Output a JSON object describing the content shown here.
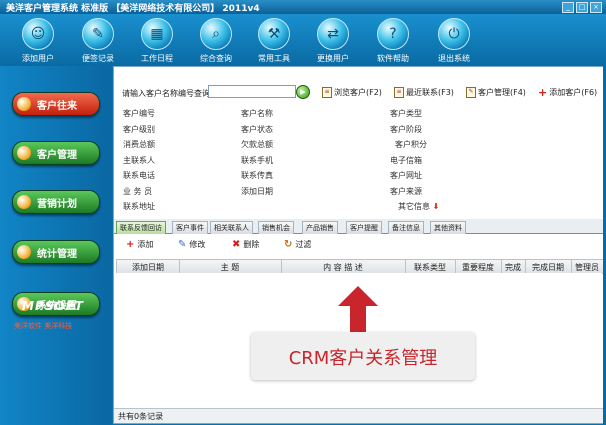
{
  "window": {
    "title": "美洋客户管理系统 标准版 【美洋网络技术有限公司】 2011v4",
    "controls": [
      "_",
      "□",
      "×"
    ]
  },
  "toolbar": [
    {
      "label": "添加用户",
      "icon": "add-user-icon"
    },
    {
      "label": "便签记录",
      "icon": "notes-icon"
    },
    {
      "label": "工作日程",
      "icon": "schedule-icon"
    },
    {
      "label": "综合查询",
      "icon": "query-icon"
    },
    {
      "label": "常用工具",
      "icon": "tools-icon"
    },
    {
      "label": "更换用户",
      "icon": "switch-user-icon"
    },
    {
      "label": "软件帮助",
      "icon": "help-icon"
    },
    {
      "label": "退出系统",
      "icon": "power-icon"
    }
  ],
  "sidebar": [
    {
      "label": "客户往来",
      "color": "#d2341c"
    },
    {
      "label": "客户管理",
      "color": "#2c8c2f"
    },
    {
      "label": "营销计划",
      "color": "#2c8c2f"
    },
    {
      "label": "统计管理",
      "color": "#2c8c2f"
    },
    {
      "label": "系统设置",
      "color": "#2c8c2f"
    }
  ],
  "logo": {
    "text": "MPSOFT",
    "tagline": "美洋软件 美洋科技"
  },
  "search": {
    "label": "请输入客户名称编号查询：",
    "value": "",
    "go": "▶"
  },
  "actions": [
    {
      "label": "浏览客户(F2)"
    },
    {
      "label": "最近联系(F3)"
    },
    {
      "label": "客户管理(F4)"
    },
    {
      "label": "添加客户(F6)"
    }
  ],
  "fields": {
    "col1": [
      "客户编号",
      "客户级别",
      "消费总额",
      "主联系人",
      "联系电话",
      "业 务 员",
      "联系地址"
    ],
    "col2": [
      "客户名称",
      "客户状态",
      "欠款总额",
      "联系手机",
      "联系传真",
      "添加日期"
    ],
    "col3": [
      "客户类型",
      "客户阶段",
      "客户积分",
      "电子信箱",
      "客户网址",
      "客户来源",
      "其它信息"
    ]
  },
  "tabs": [
    "联系反馈回访",
    "客户事件",
    "相关联系人",
    "销售机会",
    "产品销售",
    "客户提醒",
    "备注信息",
    "其他资料"
  ],
  "subtoolbar": [
    {
      "label": "添加",
      "icon": "add-icon"
    },
    {
      "label": "修改",
      "icon": "edit-icon"
    },
    {
      "label": "删除",
      "icon": "delete-icon"
    },
    {
      "label": "过滤",
      "icon": "filter-icon"
    }
  ],
  "grid": {
    "headers": [
      "添加日期",
      "主  题",
      "内 容 描 述",
      "联系类型",
      "重要程度",
      "完成",
      "完成日期",
      "管理员"
    ]
  },
  "status": "共有0条记录",
  "overlay": {
    "text": "CRM客户关系管理"
  },
  "colors": {
    "accent": "#0a6fa6",
    "overlay_red": "#c8252c"
  }
}
